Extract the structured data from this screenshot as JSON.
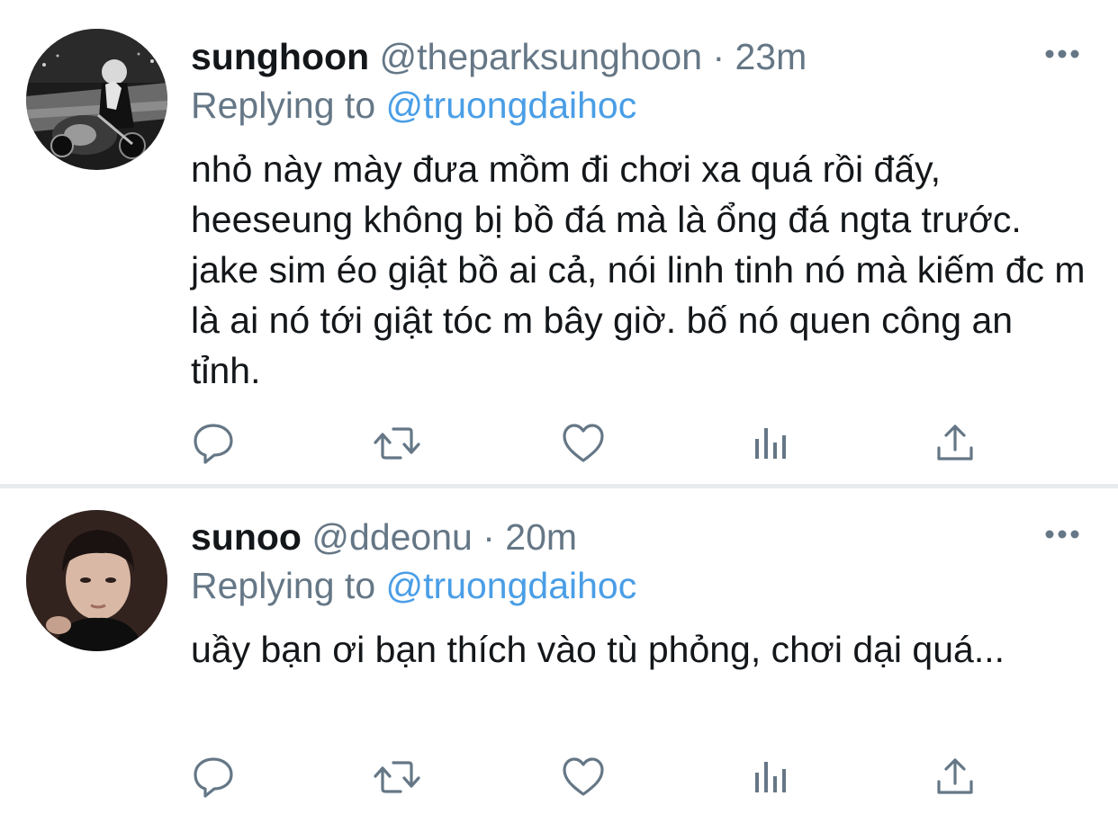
{
  "tweets": [
    {
      "display_name": "sunghoon",
      "handle": "@theparksunghoon",
      "separator": "·",
      "time": "23m",
      "replying_prefix": "Replying to",
      "replying_to": "@truongdaihoc",
      "text": "nhỏ này mày đưa mồm đi chơi xa quá rồi đấy, heeseung không bị bồ đá mà là ổng đá ngta trước. jake sim éo giật bồ ai cả, nói linh tinh nó mà kiếm đc m là ai nó tới giật tóc m bây giờ. bố nó quen công an tỉnh.",
      "avatar": "black-and-white photo of person on motorcycle"
    },
    {
      "display_name": "sunoo",
      "handle": "@ddeonu",
      "separator": "·",
      "time": "20m",
      "replying_prefix": "Replying to",
      "replying_to": "@truongdaihoc",
      "text": "uầy bạn ơi bạn thích vào tù phỏng, chơi dại quá...",
      "avatar": "dark portrait photo of young man"
    }
  ],
  "icons": {
    "more": "more-horizontal-icon",
    "reply": "reply-bubble-icon",
    "retweet": "retweet-icon",
    "like": "heart-icon",
    "stats": "analytics-bars-icon",
    "share": "share-upload-icon"
  },
  "colors": {
    "text": "#14171a",
    "secondary": "#657786",
    "link": "#4a9ee6",
    "icon": "#657786",
    "divider": "#e9ecef"
  }
}
